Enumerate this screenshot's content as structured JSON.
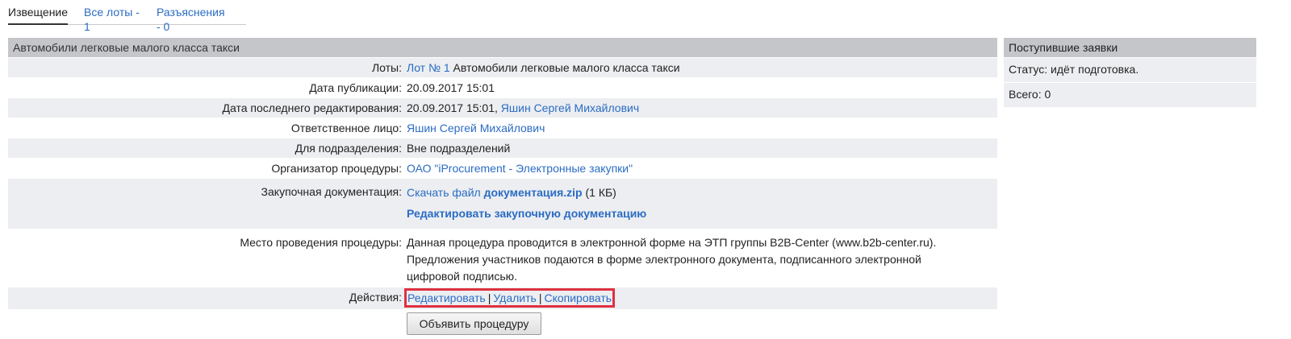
{
  "tabs": [
    {
      "label": "Извещение"
    },
    {
      "label": "Все лоты - 1"
    },
    {
      "label": "Разъяснения - 0"
    }
  ],
  "main": {
    "title": "Автомобили легковые малого класса такси",
    "lots": {
      "label": "Лоты:",
      "link": "Лот № 1",
      "text": " Автомобили легковые малого класса такси"
    },
    "published": {
      "label": "Дата публикации:",
      "value": "20.09.2017 15:01"
    },
    "edited": {
      "label": "Дата последнего редактирования:",
      "value": "20.09.2017 15:01, ",
      "link": "Яшин Сергей Михайлович"
    },
    "responsible": {
      "label": "Ответственное лицо:",
      "link": "Яшин Сергей Михайлович"
    },
    "division": {
      "label": "Для подразделения:",
      "value": "Вне подразделений"
    },
    "organizer": {
      "label": "Организатор процедуры:",
      "link": "ОАО \"iProcurement - Электронные закупки\""
    },
    "docs": {
      "label": "Закупочная документация:",
      "download": "Скачать файл ",
      "file": "документация.zip",
      "size": " (1 КБ)",
      "edit_link": "Редактировать закупочную документацию"
    },
    "place": {
      "label": "Место проведения процедуры:",
      "value": "Данная процедура проводится в электронной форме на ЭТП группы B2B-Center (www.b2b-center.ru). Предложения участников подаются в форме электронного документа, подписанного электронной цифровой подписью."
    },
    "actions": {
      "label": "Действия:",
      "edit": "Редактировать",
      "delete": "Удалить",
      "copy": "Скопировать",
      "sep": "|"
    },
    "announce_button": "Объявить процедуру"
  },
  "side": {
    "title": "Поступившие заявки",
    "status": "Статус: идёт подготовка.",
    "total": "Всего: 0"
  },
  "colors": {
    "link": "#2b6cc4",
    "header_bg": "#c4c6ca",
    "row_bg": "#eceef1",
    "highlight": "#e03040"
  }
}
